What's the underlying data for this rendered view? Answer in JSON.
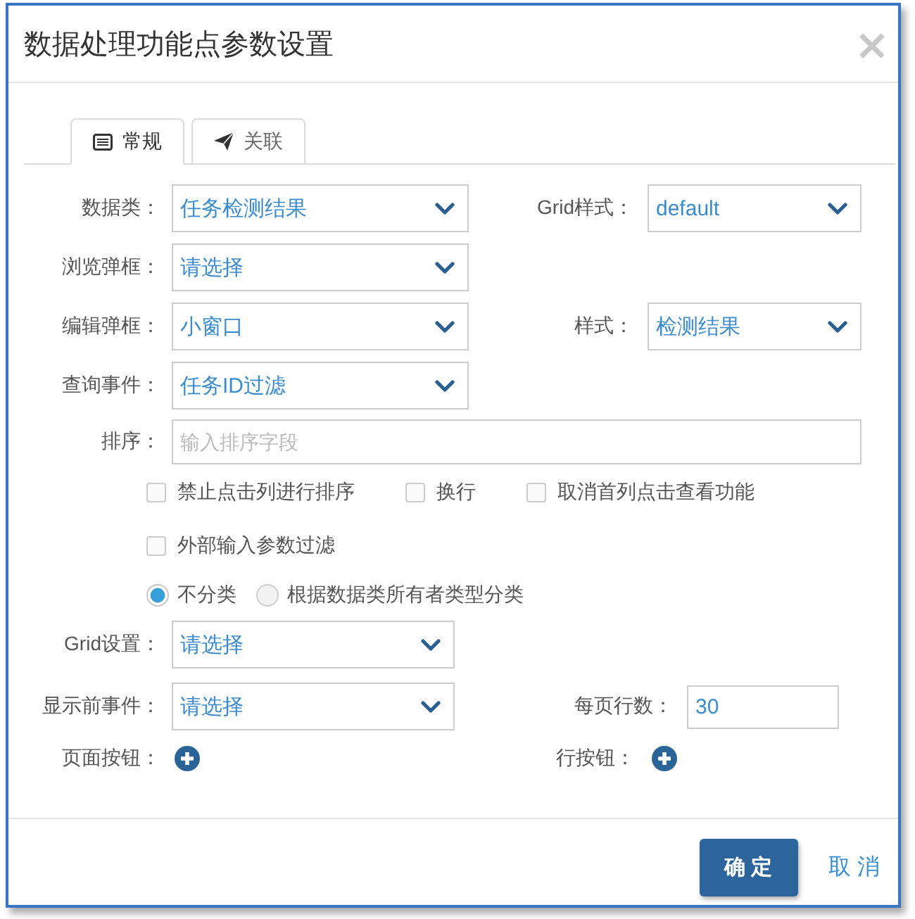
{
  "window": {
    "title": "数据处理功能点参数设置",
    "close": "×"
  },
  "tabs": [
    {
      "label": "常规",
      "selected": true
    },
    {
      "label": "关联",
      "selected": false
    }
  ],
  "top_rows": [
    {
      "fields": [
        {
          "label": "数据类：",
          "kind": "select",
          "value": "任务检测结果"
        },
        {
          "label": "Grid样式：",
          "kind": "select",
          "value": "default"
        }
      ]
    },
    {
      "fields": [
        {
          "label": "浏览弹框：",
          "kind": "select",
          "value": "请选择"
        }
      ]
    },
    {
      "fields": [
        {
          "label": "编辑弹框：",
          "kind": "select",
          "value": "小窗口"
        },
        {
          "label": "样式：",
          "kind": "select",
          "value": "检测结果"
        }
      ]
    },
    {
      "fields": [
        {
          "label": "查询事件：",
          "kind": "select",
          "value": "任务ID过滤"
        }
      ]
    }
  ],
  "sort_field": {
    "label": "排序：",
    "placeholder": "输入排序字段"
  },
  "checkbox_rows": [
    {
      "items": [
        {
          "label": "禁止点击列进行排序",
          "checked": false
        },
        {
          "label": "换行",
          "checked": false
        },
        {
          "label": "取消首列点击查看功能",
          "checked": false
        }
      ]
    },
    {
      "items": [
        {
          "label": "外部输入参数过滤",
          "checked": false
        }
      ]
    }
  ],
  "classification": [
    {
      "label": "不分类",
      "selected": true
    },
    {
      "label": "根据数据类所有者类型分类",
      "selected": false
    }
  ],
  "lower_rows": [
    {
      "fields": [
        {
          "label": "Grid设置：",
          "kind": "select",
          "value": "请选择"
        }
      ]
    },
    {
      "fields": [
        {
          "label": "显示前事件：",
          "kind": "select",
          "value": "请选择"
        },
        {
          "label": "每页行数：",
          "kind": "input",
          "value": "30"
        }
      ]
    }
  ],
  "add_buttons": [
    {
      "label": "页面按钮："
    },
    {
      "label": "行按钮："
    }
  ],
  "footer": {
    "buttons": [
      {
        "label": "确 定",
        "kind": "primary"
      },
      {
        "label": "取 消",
        "kind": "link"
      }
    ]
  }
}
